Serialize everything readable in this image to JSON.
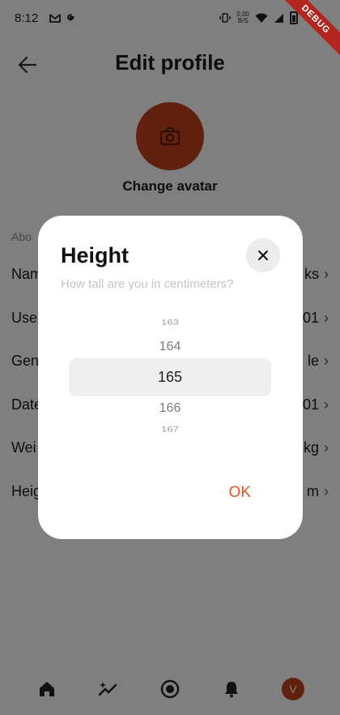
{
  "status_bar": {
    "time": "8:12",
    "net_speed_value": "0,00",
    "net_speed_unit": "B/S"
  },
  "debug_banner": "DEBUG",
  "header": {
    "title": "Edit profile",
    "back_icon": "arrow-left-icon"
  },
  "avatar": {
    "icon": "camera-icon",
    "label": "Change avatar",
    "color": "#c2421d"
  },
  "about": {
    "section_label": "Abo",
    "rows": [
      {
        "label": "Nam",
        "value": "ks"
      },
      {
        "label": "Use",
        "value": "01"
      },
      {
        "label": "Gen",
        "value": "le"
      },
      {
        "label": "Date",
        "value": "01"
      },
      {
        "label": "Wei",
        "value": "kg"
      },
      {
        "label": "Heig",
        "value": "m"
      }
    ]
  },
  "dialog": {
    "title": "Height",
    "subtitle": "How tall are you in centimeters?",
    "picker": {
      "items": [
        "163",
        "164",
        "165",
        "166",
        "167"
      ],
      "selected": "165"
    },
    "ok_label": "OK",
    "accent_color": "#e8501e"
  },
  "bottom_nav": {
    "items": [
      "home-icon",
      "sparkle-chart-icon",
      "record-icon",
      "bell-icon",
      "profile-avatar"
    ],
    "profile_initial": "V"
  }
}
